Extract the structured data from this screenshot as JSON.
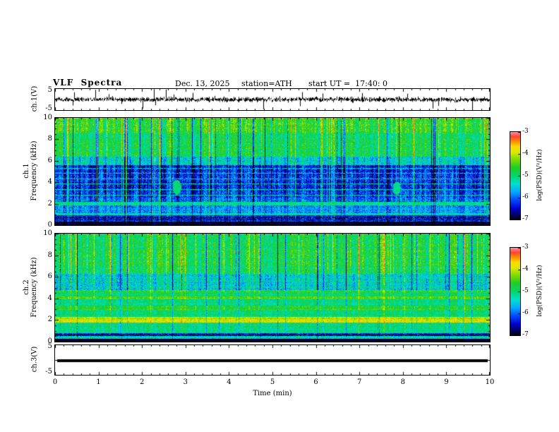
{
  "header": {
    "title": "VLF  Spectra",
    "date": "Dec. 13, 2025",
    "station": "station=ATH",
    "start_ut": "start UT =  17:40: 0"
  },
  "xaxis": {
    "label": "Time (min)",
    "min": 0,
    "max": 10,
    "ticks": [
      "0",
      "1",
      "2",
      "3",
      "4",
      "5",
      "6",
      "7",
      "8",
      "9",
      "10"
    ]
  },
  "colorbar": {
    "label": "log(PSD)(V²/Hz)",
    "min": -7,
    "max": -3,
    "ticks": [
      "-3",
      "-4",
      "-5",
      "-6",
      "-7"
    ],
    "stops": [
      {
        "t": 0.0,
        "c": "#000000"
      },
      {
        "t": 0.05,
        "c": "#000055"
      },
      {
        "t": 0.13,
        "c": "#0000cc"
      },
      {
        "t": 0.22,
        "c": "#0044ff"
      },
      {
        "t": 0.32,
        "c": "#00aaff"
      },
      {
        "t": 0.41,
        "c": "#00e0d0"
      },
      {
        "t": 0.5,
        "c": "#00d870"
      },
      {
        "t": 0.6,
        "c": "#22cc22"
      },
      {
        "t": 0.7,
        "c": "#88dd00"
      },
      {
        "t": 0.77,
        "c": "#d8ea00"
      },
      {
        "t": 0.84,
        "c": "#ffd800"
      },
      {
        "t": 0.9,
        "c": "#ff8800"
      },
      {
        "t": 0.95,
        "c": "#ff4433"
      },
      {
        "t": 1.0,
        "c": "#ff8899"
      }
    ]
  },
  "panels": {
    "wave1": {
      "ylabel": "ch.1(V)",
      "ymin": -5,
      "ymax": 5,
      "yticks": [
        "5",
        "-5"
      ]
    },
    "spec1": {
      "ylabel1": "ch.1",
      "ylabel2": "Frequency (kHz)",
      "ymin": 0,
      "ymax": 10,
      "yticks": [
        "10",
        "8",
        "6",
        "4",
        "2",
        "0"
      ]
    },
    "spec2": {
      "ylabel1": "ch.2",
      "ylabel2": "Frequency (kHz)",
      "ymin": 0,
      "ymax": 10,
      "yticks": [
        "10",
        "8",
        "6",
        "4",
        "2",
        "0"
      ]
    },
    "wave3": {
      "ylabel": "ch.3(V)",
      "ymin": -5,
      "ymax": 5,
      "yticks": [
        "5",
        "-5"
      ]
    }
  },
  "chart_data": [
    {
      "type": "line",
      "name": "ch.1 time series",
      "xlabel": "Time (min)",
      "ylabel": "ch.1(V)",
      "xlim": [
        0,
        10
      ],
      "ylim": [
        -5,
        5
      ],
      "signal": {
        "kind": "broadband noise with impulsive spikes (sferics)",
        "rms_v": 0.7,
        "spike_prob": 0.012,
        "spike_amp_v": [
          2,
          4.5
        ]
      }
    },
    {
      "type": "heatmap",
      "name": "ch.1 spectrogram",
      "xlabel": "Time (min)",
      "ylabel": "Frequency (kHz)",
      "xlim": [
        0,
        10
      ],
      "ylim": [
        0,
        10
      ],
      "zlabel": "log(PSD)(V²/Hz)",
      "zlim": [
        -7,
        -3
      ],
      "bands": [
        {
          "f": [
            0,
            0.35
          ],
          "psd": -6.9,
          "noise": 0.25,
          "streak": 0.15
        },
        {
          "f": [
            0.35,
            0.95
          ],
          "psd": -6.3,
          "noise": 0.5,
          "streak": 0.3
        },
        {
          "f": [
            0.95,
            1.15
          ],
          "psd": -5.3,
          "noise": 0.35,
          "streak": 0.3
        },
        {
          "f": [
            1.15,
            1.9
          ],
          "psd": -5.75,
          "noise": 0.45,
          "streak": 0.4
        },
        {
          "f": [
            1.9,
            2.2
          ],
          "psd": -5.05,
          "noise": 0.3,
          "streak": 0.3
        },
        {
          "f": [
            2.2,
            2.6
          ],
          "psd": -6.0,
          "noise": 0.45,
          "streak": 0.6
        },
        {
          "f": [
            2.6,
            5.6
          ],
          "psd": -6.25,
          "noise": 0.5,
          "streak": 0.75
        },
        {
          "f": [
            5.6,
            6.4
          ],
          "psd": -5.4,
          "noise": 0.45,
          "streak": 0.7
        },
        {
          "f": [
            6.4,
            8.6
          ],
          "psd": -4.85,
          "noise": 0.4,
          "streak": 0.65
        },
        {
          "f": [
            8.6,
            10.1
          ],
          "psd": -4.6,
          "noise": 0.45,
          "streak": 0.7
        }
      ],
      "hlines": [
        {
          "f": 0.15,
          "psd": -7,
          "dash": 0.9
        },
        {
          "f": 0.5,
          "psd": -7,
          "dash": 0.85
        },
        {
          "f": 0.75,
          "psd": -6.9,
          "dash": 0.7
        },
        {
          "f": 2.85,
          "psd": -5.35,
          "dash": 0.95
        },
        {
          "f": 3.35,
          "psd": -5.3,
          "dash": 0.95
        },
        {
          "f": 3.85,
          "psd": -5.35,
          "dash": 0.9
        },
        {
          "f": 4.35,
          "psd": -5.3,
          "dash": 0.9
        },
        {
          "f": 4.85,
          "psd": -5.4,
          "dash": 0.85
        },
        {
          "f": 5.35,
          "psd": -5.4,
          "dash": 0.8
        }
      ],
      "blobs": [
        {
          "x": 2.8,
          "f": 3.6,
          "rx": 0.1,
          "ry": 0.7,
          "psd": -5.0
        },
        {
          "x": 7.85,
          "f": 3.5,
          "rx": 0.09,
          "ry": 0.6,
          "psd": -5.1
        }
      ]
    },
    {
      "type": "heatmap",
      "name": "ch.2 spectrogram",
      "xlabel": "Time (min)",
      "ylabel": "Frequency (kHz)",
      "xlim": [
        0,
        10
      ],
      "ylim": [
        0,
        10
      ],
      "zlabel": "log(PSD)(V²/Hz)",
      "zlim": [
        -7,
        -3
      ],
      "bands": [
        {
          "f": [
            0,
            0.3
          ],
          "psd": -6.9,
          "noise": 0.25,
          "streak": 0.1
        },
        {
          "f": [
            0.3,
            0.55
          ],
          "psd": -5.3,
          "noise": 0.45,
          "streak": 0.2
        },
        {
          "f": [
            0.55,
            0.8
          ],
          "psd": -6.4,
          "noise": 0.5,
          "streak": 0.2
        },
        {
          "f": [
            0.8,
            1.8
          ],
          "psd": -5.05,
          "noise": 0.35,
          "streak": 0.3
        },
        {
          "f": [
            1.8,
            2.3
          ],
          "psd": -4.0,
          "noise": 0.3,
          "streak": 0.25
        },
        {
          "f": [
            2.3,
            2.95
          ],
          "psd": -5.0,
          "noise": 0.3,
          "streak": 0.3
        },
        {
          "f": [
            2.95,
            3.35
          ],
          "psd": -4.65,
          "noise": 0.3,
          "streak": 0.3
        },
        {
          "f": [
            3.35,
            3.95
          ],
          "psd": -5.05,
          "noise": 0.3,
          "streak": 0.35
        },
        {
          "f": [
            3.95,
            4.2
          ],
          "psd": -4.5,
          "noise": 0.3,
          "streak": 0.3
        },
        {
          "f": [
            4.2,
            4.6
          ],
          "psd": -5.0,
          "noise": 0.3,
          "streak": 0.35
        },
        {
          "f": [
            4.6,
            4.8
          ],
          "psd": -4.55,
          "noise": 0.25,
          "streak": 0.3
        },
        {
          "f": [
            4.8,
            6.3
          ],
          "psd": -5.35,
          "noise": 0.5,
          "streak": 0.55
        },
        {
          "f": [
            6.3,
            10.1
          ],
          "psd": -4.8,
          "noise": 0.42,
          "streak": 0.68
        }
      ],
      "hlines": [
        {
          "f": 0.12,
          "psd": -7,
          "dash": 0.9
        },
        {
          "f": 0.65,
          "psd": -7,
          "dash": 0.8
        },
        {
          "f": 1.35,
          "psd": -5.6,
          "dash": 0.5
        },
        {
          "f": 2.0,
          "psd": -3.7,
          "dash": 0.35
        },
        {
          "f": 2.1,
          "psd": -4.0,
          "dash": 0.3
        },
        {
          "f": 3.6,
          "psd": -5.5,
          "dash": 0.4
        },
        {
          "f": 4.05,
          "psd": -4.1,
          "dash": 0.3
        }
      ],
      "blobs": []
    },
    {
      "type": "line",
      "name": "ch.3 time series",
      "xlabel": "Time (min)",
      "ylabel": "ch.3(V)",
      "xlim": [
        0,
        10
      ],
      "ylim": [
        -5,
        5
      ],
      "signal": {
        "kind": "constant flat line (no signal)",
        "level_v": -0.3
      }
    }
  ]
}
